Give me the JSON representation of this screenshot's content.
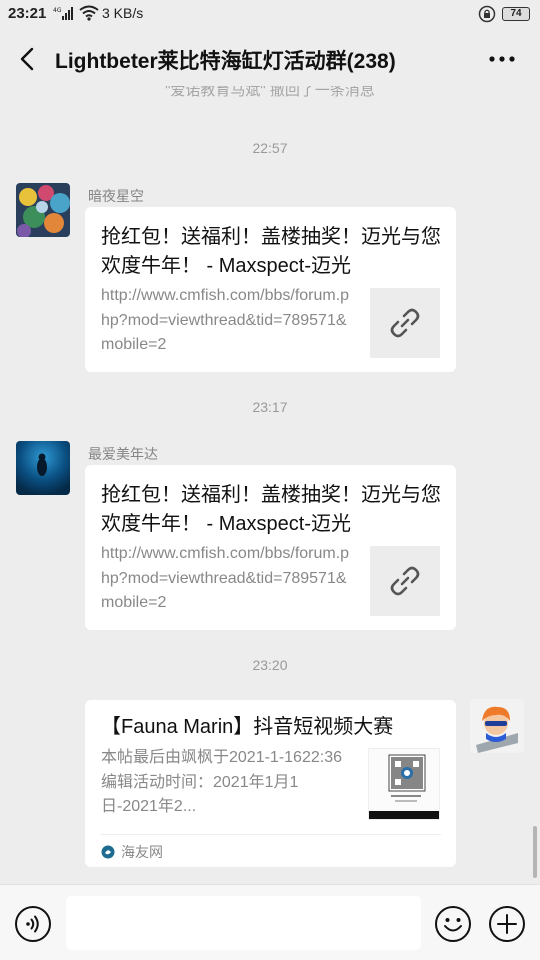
{
  "status_bar": {
    "time": "23:21",
    "network_type": "4G",
    "speed": "3 KB/s",
    "battery": "74"
  },
  "header": {
    "title": "Lightbeter莱比特海缸灯活动群(238)"
  },
  "recall_notice": "\"爱诺教育马斌\" 撤回了一条消息",
  "messages": [
    {
      "timestamp": "22:57",
      "sender": "暗夜星空",
      "card": {
        "title": "抢红包！送福利！盖楼抽奖！迈光与您欢度牛年！ - Maxspect-迈光",
        "description": "http://www.cmfish.com/bbs/forum.php?mod=viewthread&tid=789571&mobile=2",
        "thumb_icon": "link-icon"
      }
    },
    {
      "timestamp": "23:17",
      "sender": "最爱美年达",
      "card": {
        "title": "抢红包！送福利！盖楼抽奖！迈光与您欢度牛年！ - Maxspect-迈光",
        "description": "http://www.cmfish.com/bbs/forum.php?mod=viewthread&tid=789571&mobile=2",
        "thumb_icon": "link-icon"
      }
    },
    {
      "timestamp": "23:20",
      "sender": "",
      "card": {
        "title": "【Fauna Marin】抖音短视频大赛",
        "description": "本帖最后由飒枫于2021-1-1622:36编辑活动时间：2021年1月1日-2021年2...",
        "source": "海友网",
        "thumb_icon": "qr-code-icon"
      }
    }
  ],
  "input": {
    "placeholder": ""
  },
  "colors": {
    "background": "#ededed",
    "card": "#ffffff",
    "meta_text": "#9a9a9a"
  }
}
